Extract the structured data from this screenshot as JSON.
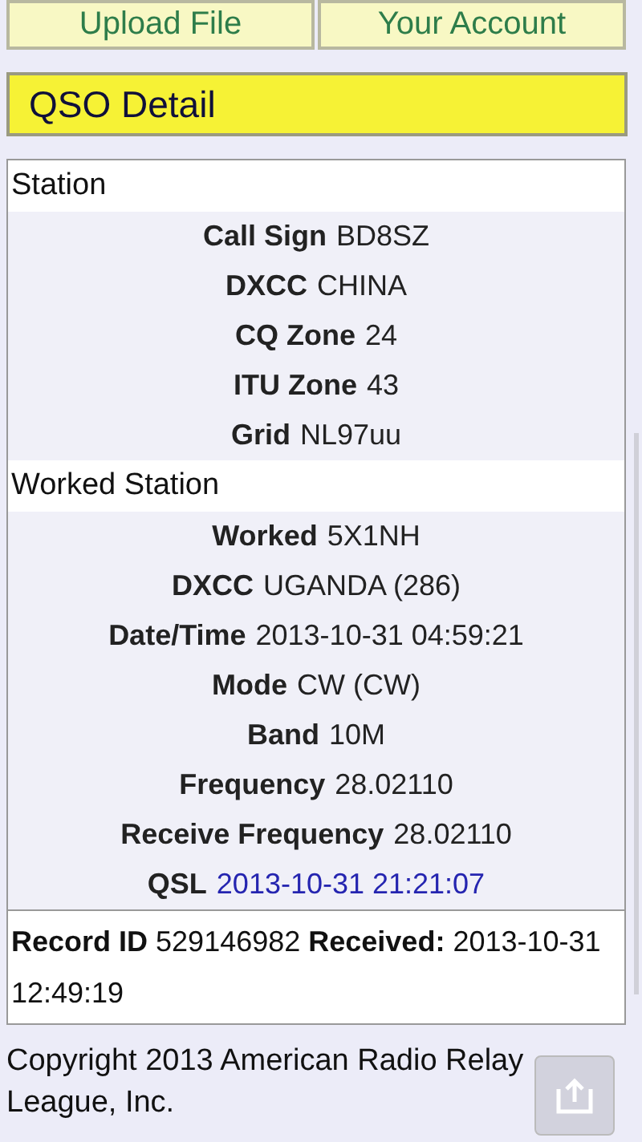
{
  "nav_buttons": [
    "Upload File",
    "Your Account"
  ],
  "page_title": "QSO Detail",
  "sections": [
    {
      "title": "Station",
      "fields": [
        {
          "label": "Call Sign",
          "value": "BD8SZ",
          "kind": "text"
        },
        {
          "label": "DXCC",
          "value": "CHINA",
          "kind": "text"
        },
        {
          "label": "CQ Zone",
          "value": "24",
          "kind": "text"
        },
        {
          "label": "ITU Zone",
          "value": "43",
          "kind": "text"
        },
        {
          "label": "Grid",
          "value": "NL97uu",
          "kind": "text"
        }
      ]
    },
    {
      "title": "Worked Station",
      "fields": [
        {
          "label": "Worked",
          "value": "5X1NH",
          "kind": "text"
        },
        {
          "label": "DXCC",
          "value": "UGANDA (286)",
          "kind": "text"
        },
        {
          "label": "Date/Time",
          "value": "2013-10-31 04:59:21",
          "kind": "text"
        },
        {
          "label": "Mode",
          "value": "CW (CW)",
          "kind": "text"
        },
        {
          "label": "Band",
          "value": "10M",
          "kind": "text"
        },
        {
          "label": "Frequency",
          "value": "28.02110",
          "kind": "text"
        },
        {
          "label": "Receive Frequency",
          "value": "28.02110",
          "kind": "text"
        },
        {
          "label": "QSL",
          "value": "2013-10-31 21:21:07",
          "kind": "link"
        }
      ]
    }
  ],
  "record": {
    "text": "**Record ID** 529146982 **Received:** 2013-10-31 12:49:19"
  },
  "footer": "Copyright 2013 American Radio Relay League, Inc."
}
